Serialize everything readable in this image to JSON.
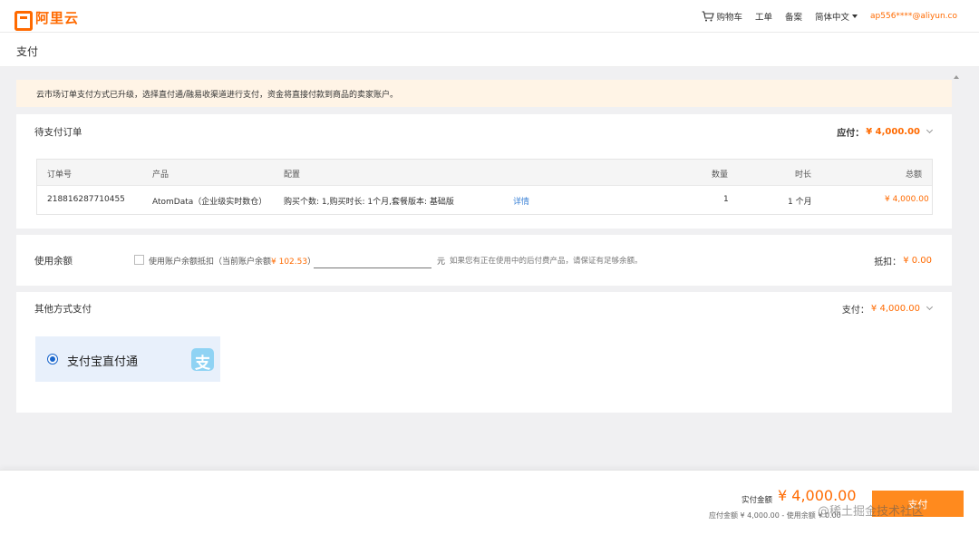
{
  "header": {
    "logo_text": "阿里云",
    "nav": {
      "cart": "购物车",
      "tickets": "工单",
      "filing": "备案",
      "language": "简体中文",
      "user": "ap556****@aliyun.co"
    }
  },
  "page": {
    "title": "支付"
  },
  "notice": "云市场订单支付方式已升级，选择直付通/融易收渠道进行支付，资金将直接付款到商品的卖家账户。",
  "order_card": {
    "title": "待支付订单",
    "payable_label": "应付：",
    "payable_amount": "¥ 4,000.00",
    "table": {
      "headers": [
        "订单号",
        "产品",
        "配置",
        "数量",
        "时长",
        "总额"
      ],
      "rows": [
        {
          "order_id": "218816287710455",
          "product": "AtomData（企业级实时数仓）",
          "config": "购买个数: 1,购买时长: 1个月,套餐版本: 基础版",
          "detail_link": "详情",
          "quantity": "1",
          "duration": "1 个月",
          "amount": "¥ 4,000.00"
        }
      ]
    }
  },
  "balance_card": {
    "title": "使用余额",
    "checkbox_label": "使用账户余额抵扣（当前账户余额",
    "balance_value": "¥ 102.53",
    "checkbox_label_end": "）",
    "input_value": "",
    "unit": "元",
    "hint": "如果您有正在使用中的后付费产品，请保证有足够余额。",
    "deduct_label": "抵扣：",
    "deduct_amount": "¥ 0.00"
  },
  "other_card": {
    "title": "其他方式支付",
    "pay_label": "支付：",
    "pay_amount": "¥ 4,000.00",
    "option_label": "支付宝直付通",
    "option_icon_glyph": "支"
  },
  "bottom": {
    "actual_label": "实付金额",
    "actual_amount": "¥ 4,000.00",
    "summary": "应付金额 ¥ 4,000.00 - 使用余额 ¥ 0.00",
    "pay_button": "支付",
    "watermark": "@稀土掘金技术社区"
  },
  "colors": {
    "accent": "#ff6a00",
    "link": "#3b82d6",
    "notice_bg": "#fff4e6",
    "option_bg": "#e8f0fb"
  },
  "icons": {
    "logo": "aliyun-logo-icon",
    "cart": "cart-icon",
    "language_caret": "caret-down-icon",
    "collapse": "chevron-down-icon",
    "radio": "radio-selected-icon",
    "alipay": "alipay-icon"
  }
}
